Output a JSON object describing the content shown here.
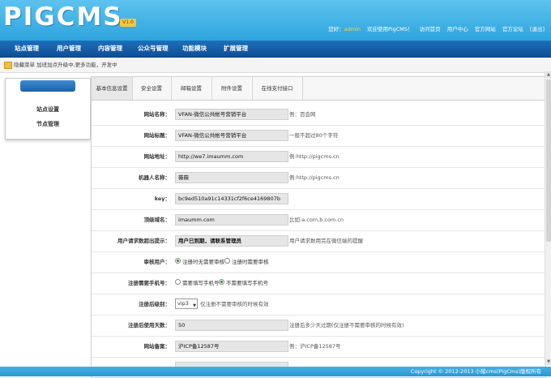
{
  "header": {
    "logo": "PIGCMS",
    "version": "V1.0",
    "greeting": "您好：",
    "user": "admin",
    "welcome": "欢迎使用PigCMS！",
    "links": [
      "访问首页",
      "用户中心",
      "官方网站",
      "官方论坛",
      "[退出]"
    ]
  },
  "nav": {
    "items": [
      "站点管理",
      "用户管理",
      "内容管理",
      "公众号管理",
      "功能模块",
      "扩展管理"
    ]
  },
  "notice": {
    "text": "隐藏菜单 加班加点升级中,更多功能，开发中"
  },
  "sidebar": {
    "items": [
      "站点设置",
      "节点管理"
    ]
  },
  "tabs": [
    "基本信息设置",
    "安全设置",
    "邮箱设置",
    "附件设置",
    "在线支付接口"
  ],
  "form": {
    "site_name": {
      "label": "网站名称：",
      "value": "VFAN-微信公共帐号营销平台",
      "hint": "例：百会网"
    },
    "site_title": {
      "label": "网站标题：",
      "value": "VFAN-微信公共帐号营销平台",
      "hint": "一般不超过80个字符"
    },
    "site_url": {
      "label": "网站地址：",
      "value": "http://we7.imaumm.com",
      "hint": "例:http://pigcms.cn"
    },
    "robot_name": {
      "label": "机器人名称：",
      "value": "薇薇",
      "hint": "例:http://pigcms.cn"
    },
    "key": {
      "label": "key：",
      "value": "bc9ed510a91c14331cf2f6ce4169807b"
    },
    "top_domain": {
      "label": "顶级域名：",
      "value": "imaumm.com",
      "hint": "比如:a.com,b.com.cn"
    },
    "expire_msg": {
      "label": "用户请求数超出提示：",
      "value": "用户已到期，请联系管理员",
      "hint": "用户请求数用完在微信端的提醒"
    },
    "review": {
      "label": "审核用户：",
      "options": [
        "注册时无需要审核",
        "注册时需要审核"
      ]
    },
    "phone": {
      "label": "注册需要手机号：",
      "options": [
        "需要填写手机号",
        "不需要填写手机号"
      ]
    },
    "reg_level": {
      "label": "注册后级别：",
      "value": "vip3",
      "hint": "仅注册不需要审核的时候有效"
    },
    "reg_days": {
      "label": "注册后使用天数：",
      "value": "50",
      "hint": "注册后多少天过期(仅注册不需要审核的时候有效)"
    },
    "icp": {
      "label": "网站备案：",
      "value": "沪ICP备12587号",
      "hint": "例：沪ICP备12587号"
    }
  },
  "footer": {
    "text": "Copyright © 2012-2013 小猪cms(PigCms)版权所有"
  }
}
